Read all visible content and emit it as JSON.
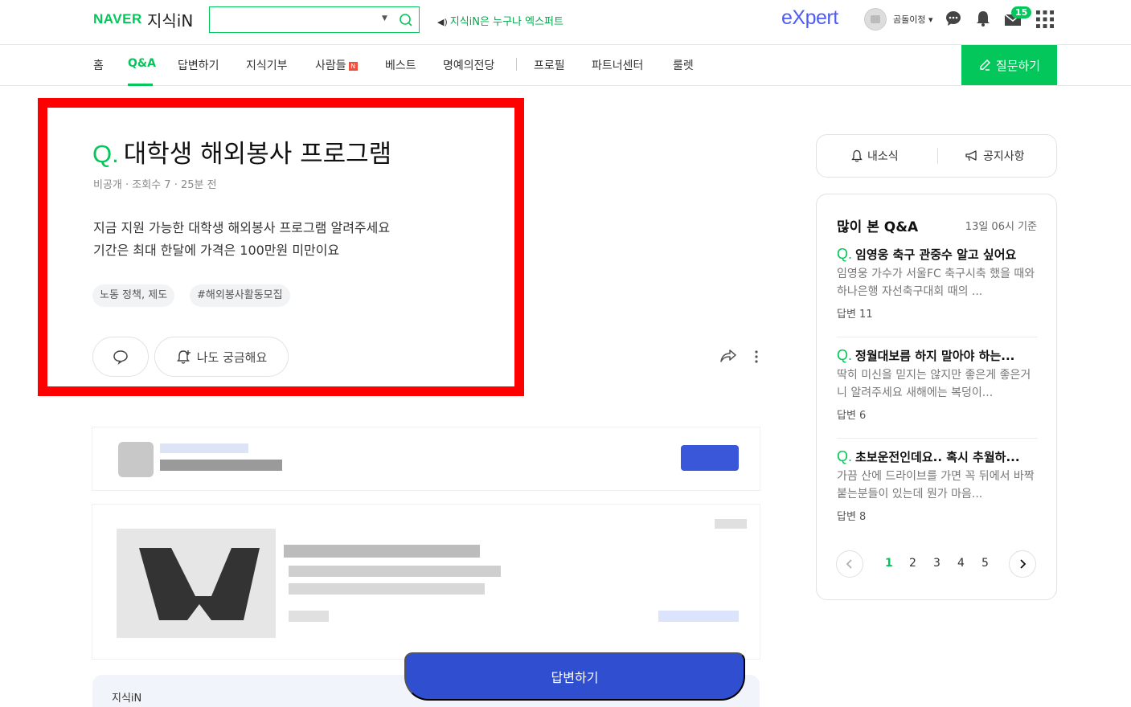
{
  "header": {
    "logo_naver": "NAVER",
    "logo_service": "지식iN",
    "search_placeholder": "",
    "notice": "지식iN은 누구나 엑스퍼트",
    "expert_logo": "eXpert",
    "username": "곰돌이정",
    "message_count": "15"
  },
  "nav": {
    "items": [
      "홈",
      "Q&A",
      "답변하기",
      "지식기부",
      "사람들",
      "베스트",
      "명예의전당",
      "프로필",
      "파트너센터",
      "룰렛"
    ],
    "new_badge": "N",
    "ask_button": "질문하기"
  },
  "question": {
    "q_mark": "Q.",
    "title": "대학생 해외봉사 프로그램",
    "meta": "비공개 · 조회수 7 · 25분 전",
    "body_line1": "지금 지원 가능한 대학생 해외봉사 프로그램 알려주세요",
    "body_line2": "기간은 최대 한달에 가격은 100만원 미만이요",
    "tags": [
      "노동 정책, 제도",
      "#해외봉사활동모집"
    ],
    "curious_button": "나도 궁금해요"
  },
  "sidebar": {
    "tab_news": "내소식",
    "tab_notice": "공지사항",
    "popular_title": "많이 본 Q&A",
    "popular_time": "13일 06시 기준",
    "items": [
      {
        "title": "임영웅 축구 관중수 알고 싶어요",
        "desc": "임영웅 가수가 서울FC 축구시축 했을 때와 하나은행 자선축구대회 때의 ...",
        "answers": "답변 11"
      },
      {
        "title": "정월대보름 하지 말아야 하는...",
        "desc": "딱히 미신을 믿지는 않지만 좋은게 좋은거니 알려주세요 새해에는 복덩이...",
        "answers": "답변 6"
      },
      {
        "title": "초보운전인데요.. 혹시 추월하...",
        "desc": "가끔 산에 드라이브를 가면 꼭 뒤에서 바짝 붙는분들이 있는데 뭔가 마음...",
        "answers": "답변 8"
      }
    ],
    "pages": [
      "1",
      "2",
      "3",
      "4",
      "5"
    ]
  },
  "bottom": {
    "panel_label": "지식iN",
    "answer_button": "답변하기"
  }
}
